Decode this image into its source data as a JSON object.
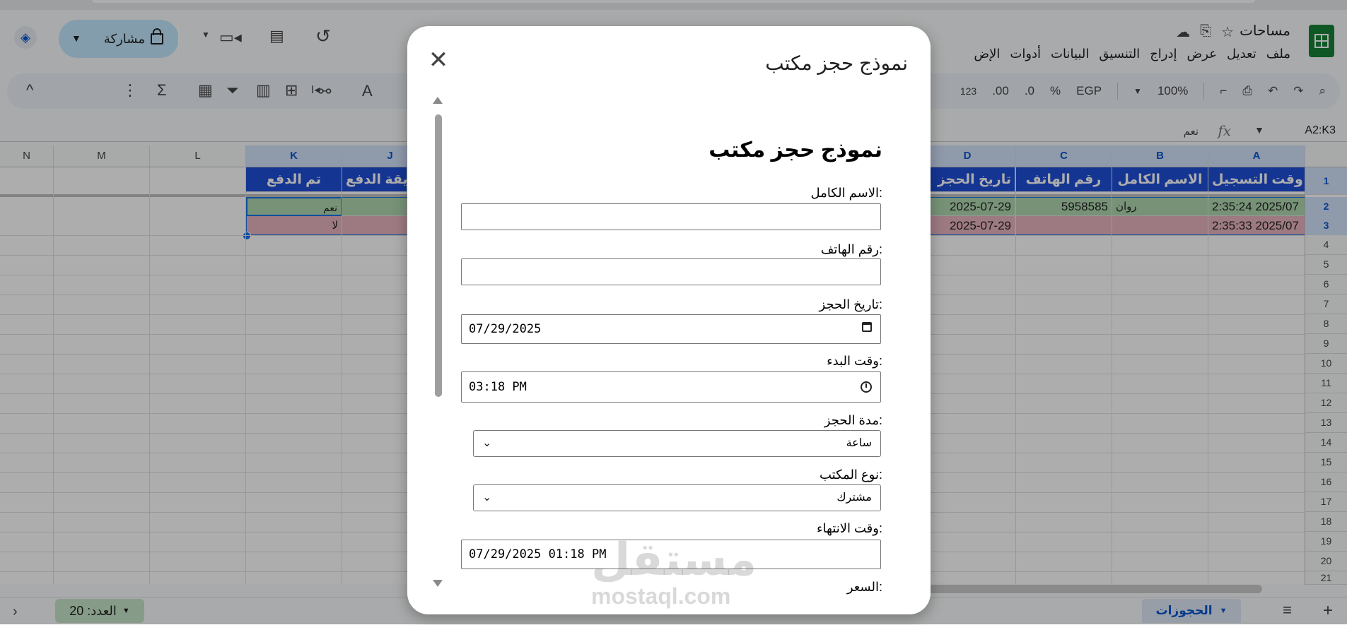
{
  "app": {
    "doc_title": "مساحات",
    "menu": [
      "ملف",
      "تعديل",
      "عرض",
      "إدراج",
      "التنسيق",
      "البيانات",
      "أدوات",
      "الإض"
    ],
    "share_label": "مشاركة",
    "zoom": "100%",
    "currency": "EGP",
    "percent": "%",
    "dec_less": ".0",
    "dec_more": ".00",
    "num_format": "123",
    "name_box": "A2:K3",
    "formula_value": "نعم",
    "fx": "fx"
  },
  "grid": {
    "columns_left": [
      "N",
      "M",
      "L",
      "K",
      "J"
    ],
    "columns_right": [
      "D",
      "C",
      "B",
      "A"
    ],
    "header_row": {
      "A": "وقت التسجيل",
      "B": "الاسم الكامل",
      "C": "رقم الهاتف",
      "D": "تاريخ الحجز",
      "J": "يقة الدفع",
      "K": "تم الدفع"
    },
    "rows": [
      {
        "A": "2:35:24 2025/07",
        "B": "روان",
        "C": "5958585",
        "D": "2025-07-29",
        "K": "نعم"
      },
      {
        "A": "2:35:33 2025/07",
        "B": "",
        "C": "",
        "D": "2025-07-29",
        "K": "لا"
      }
    ],
    "row_numbers": [
      "1",
      "2",
      "3",
      "4",
      "5",
      "6",
      "7",
      "8",
      "9",
      "10",
      "11",
      "12",
      "13",
      "14",
      "15",
      "16",
      "17",
      "18",
      "19",
      "20",
      "21"
    ]
  },
  "bottom": {
    "sheet_tab": "الحجوزات",
    "count_label": "العدد: 20"
  },
  "dialog": {
    "title": "نموذج حجز مكتب",
    "form_heading": "نموذج حجز مكتب",
    "fields": {
      "full_name_label": "الاسم الكامل:",
      "full_name_value": "",
      "phone_label": "رقم الهاتف:",
      "phone_value": "",
      "date_label": "تاريخ الحجز:",
      "date_value": "07/29/2025",
      "start_label": "وقت البدء:",
      "start_value": "03:18 PM",
      "duration_label": "مدة الحجز:",
      "duration_value": "ساعة",
      "office_label": "نوع المكتب:",
      "office_value": "مشترك",
      "end_label": "وقت الانتهاء:",
      "end_value": "07/29/2025 01:18 PM",
      "price_label": "السعر:"
    }
  },
  "watermark": {
    "arabic": "مستقل",
    "latin": "mostaql.com"
  }
}
